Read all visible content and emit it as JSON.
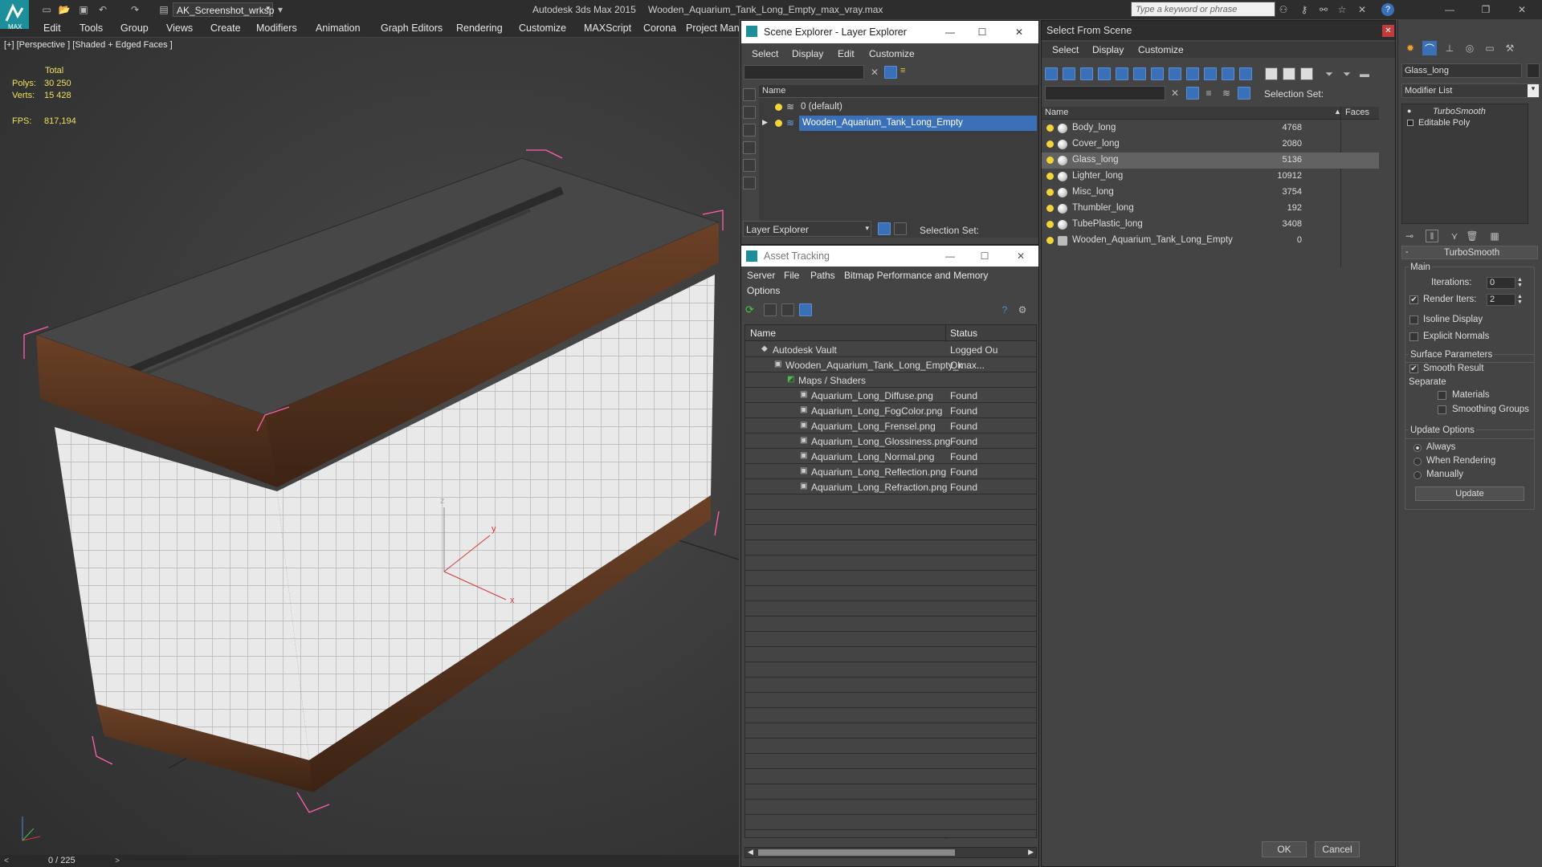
{
  "app": {
    "title_app": "Autodesk 3ds Max  2015",
    "title_file": "Wooden_Aquarium_Tank_Long_Empty_max_vray.max",
    "workspace": "AK_Screenshot_wrksp",
    "logo_text": "MAX",
    "search_placeholder": "Type a keyword or phrase"
  },
  "menu": [
    "Edit",
    "Tools",
    "Group",
    "Views",
    "Create",
    "Modifiers",
    "Animation",
    "Graph Editors",
    "Rendering",
    "Customize",
    "MAXScript",
    "Corona",
    "Project Man"
  ],
  "viewport": {
    "label": "[+] [Perspective ] [Shaded + Edged Faces ]",
    "stats_header": "Total",
    "polys_label": "Polys:",
    "polys_value": "30 250",
    "verts_label": "Verts:",
    "verts_value": "15 428",
    "fps_label": "FPS:",
    "fps_value": "817,194",
    "gizmo_x": "x",
    "gizmo_y": "y",
    "gizmo_z": "z"
  },
  "timeline": {
    "counter": "0 / 225"
  },
  "scene_explorer": {
    "title": "Scene Explorer - Layer Explorer",
    "menu": [
      "Select",
      "Display",
      "Edit",
      "Customize"
    ],
    "col_name": "Name",
    "rows": [
      "0 (default)",
      "Wooden_Aquarium_Tank_Long_Empty"
    ],
    "dropdown": "Layer Explorer",
    "selection_set_label": "Selection Set:"
  },
  "asset_tracking": {
    "title": "Asset Tracking",
    "menu": [
      "Server",
      "File",
      "Paths",
      "Bitmap Performance and Memory",
      "Options"
    ],
    "col_name": "Name",
    "col_status": "Status",
    "rows": [
      {
        "name": "Autodesk Vault",
        "status": "Logged Ou",
        "indent": 0,
        "icon": "vault"
      },
      {
        "name": "Wooden_Aquarium_Tank_Long_Empty_max...",
        "status": "Ok",
        "indent": 1,
        "icon": "file"
      },
      {
        "name": "Maps / Shaders",
        "status": "",
        "indent": 2,
        "icon": "maps"
      },
      {
        "name": "Aquarium_Long_Diffuse.png",
        "status": "Found",
        "indent": 3,
        "icon": "image"
      },
      {
        "name": "Aquarium_Long_FogColor.png",
        "status": "Found",
        "indent": 3,
        "icon": "image"
      },
      {
        "name": "Aquarium_Long_Frensel.png",
        "status": "Found",
        "indent": 3,
        "icon": "image"
      },
      {
        "name": "Aquarium_Long_Glossiness.png",
        "status": "Found",
        "indent": 3,
        "icon": "image"
      },
      {
        "name": "Aquarium_Long_Normal.png",
        "status": "Found",
        "indent": 3,
        "icon": "image"
      },
      {
        "name": "Aquarium_Long_Reflection.png",
        "status": "Found",
        "indent": 3,
        "icon": "image"
      },
      {
        "name": "Aquarium_Long_Refraction.png",
        "status": "Found",
        "indent": 3,
        "icon": "image"
      }
    ]
  },
  "select_from_scene": {
    "title": "Select From Scene",
    "menu": [
      "Select",
      "Display",
      "Customize"
    ],
    "selection_set_label": "Selection Set:",
    "col_name": "Name",
    "col_faces": "Faces",
    "rows": [
      {
        "name": "Body_long",
        "faces": "4768",
        "selected": false
      },
      {
        "name": "Cover_long",
        "faces": "2080",
        "selected": false
      },
      {
        "name": "Glass_long",
        "faces": "5136",
        "selected": true
      },
      {
        "name": "Lighter_long",
        "faces": "10912",
        "selected": false
      },
      {
        "name": "Misc_long",
        "faces": "3754",
        "selected": false
      },
      {
        "name": "Thumbler_long",
        "faces": "192",
        "selected": false
      },
      {
        "name": "TubePlastic_long",
        "faces": "3408",
        "selected": false
      },
      {
        "name": "Wooden_Aquarium_Tank_Long_Empty",
        "faces": "0",
        "selected": false
      }
    ],
    "ok": "OK",
    "cancel": "Cancel"
  },
  "modify_panel": {
    "object_name": "Glass_long",
    "modifier_list": "Modifier List",
    "stack": [
      "TurboSmooth",
      "Editable Poly"
    ],
    "rollout_title": "TurboSmooth",
    "main_label": "Main",
    "iterations_label": "Iterations:",
    "iterations_value": "0",
    "render_iters_label": "Render Iters:",
    "render_iters_value": "2",
    "render_iters_checked": true,
    "isoline_label": "Isoline Display",
    "explicit_normals_label": "Explicit Normals",
    "surface_params_label": "Surface Parameters",
    "smooth_result_label": "Smooth Result",
    "smooth_result_checked": true,
    "separate_label": "Separate",
    "materials_label": "Materials",
    "smoothing_groups_label": "Smoothing Groups",
    "update_options_label": "Update Options",
    "always_label": "Always",
    "when_rendering_label": "When Rendering",
    "manually_label": "Manually",
    "update_button": "Update"
  },
  "colors": {
    "accent": "#3a70b8",
    "selection_row": "#626262",
    "wire_pink": "#ff5fb0",
    "wood": "#4a2b1a"
  }
}
